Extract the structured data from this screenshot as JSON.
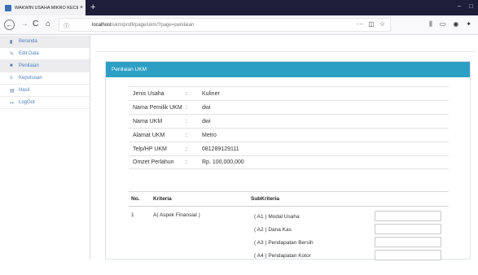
{
  "browser": {
    "tab_title": "WAKWIN USAHA MIKRO KECIL D",
    "tab_close": "×",
    "new_tab": "+",
    "win_min": "–",
    "win_max": "□",
    "url_host": "localhost",
    "url_path": "/ukm/profil/page/ukm/?page=penilaian",
    "nav_back": "←",
    "nav_forward": "→",
    "nav_reload": "C",
    "nav_home": "⌂",
    "url_more": "···",
    "url_pocket": "◫",
    "url_star": "☆",
    "tb_library": "⫼",
    "tb_reader": "▭",
    "tb_account": "◉",
    "tb_ext": "✦"
  },
  "sidebar": {
    "items": [
      {
        "icon": "▮",
        "label": "Beranda"
      },
      {
        "icon": "✎",
        "label": "Edit Data"
      },
      {
        "icon": "■",
        "label": "Penilaian"
      },
      {
        "icon": "≡",
        "label": "Keputusan"
      },
      {
        "icon": "▤",
        "label": "Hasil"
      },
      {
        "icon": "↦",
        "label": "LogOut"
      }
    ]
  },
  "panel": {
    "title": "Penilaian UKM"
  },
  "info": {
    "rows": [
      {
        "key": "Jenis Usaha",
        "sep": ":",
        "value": "Kuliner"
      },
      {
        "key": "Nama Pemilik UKM",
        "sep": ":",
        "value": "dwi"
      },
      {
        "key": "Nama UKM",
        "sep": ":",
        "value": "dwi"
      },
      {
        "key": "Alamat UKM",
        "sep": ":",
        "value": "Metro"
      },
      {
        "key": "Telp/HP UKM",
        "sep": ":",
        "value": "081289129111"
      },
      {
        "key": "Omzet Perlahun",
        "sep": ":",
        "value": "Rp. 100,000,000"
      }
    ]
  },
  "criteria": {
    "headers": {
      "no": "No.",
      "kriteria": "Kriteria",
      "sub": "SubKriteria"
    },
    "rows": [
      {
        "no": "1",
        "kriteria": "A( Aspek Finansial )",
        "subs": [
          "( A1 ) Modal Usaha",
          "( A2 ) Dana Kas",
          "( A3 ) Pendapatan Bersih",
          "( A4 ) Pendapatan Kotor"
        ]
      }
    ]
  }
}
